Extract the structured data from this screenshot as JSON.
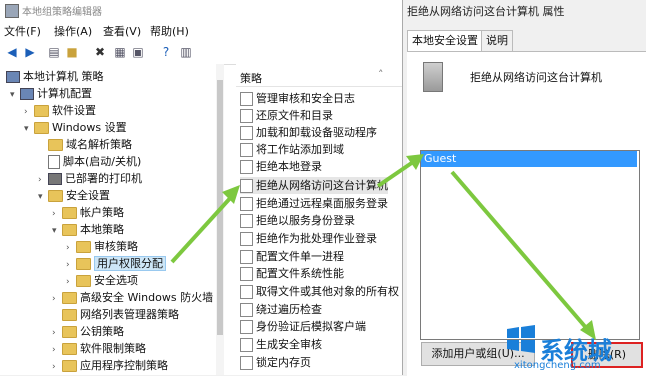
{
  "editor": {
    "title": "本地组策略编辑器",
    "menu": [
      "文件(F)",
      "操作(A)",
      "查看(V)",
      "帮助(H)"
    ],
    "toolbar_icons": [
      "back-icon",
      "forward-icon",
      "up-icon",
      "folder-icon",
      "delete-icon",
      "properties-icon",
      "export-icon",
      "help-icon",
      "view-icon"
    ],
    "tree": [
      {
        "label": "本地计算机 策略",
        "level": 0,
        "icon": "pc-icon",
        "arrow": ""
      },
      {
        "label": "计算机配置",
        "level": 1,
        "icon": "pc-icon",
        "arrow": "▾"
      },
      {
        "label": "软件设置",
        "level": 2,
        "icon": "folder-icon",
        "arrow": "›"
      },
      {
        "label": "Windows 设置",
        "level": 2,
        "icon": "folder-icon",
        "arrow": "▾"
      },
      {
        "label": "域名解析策略",
        "level": 3,
        "icon": "folder-icon",
        "arrow": ""
      },
      {
        "label": "脚本(启动/关机)",
        "level": 3,
        "icon": "doc-icon",
        "arrow": ""
      },
      {
        "label": "已部署的打印机",
        "level": 3,
        "icon": "printer-icon",
        "arrow": "›"
      },
      {
        "label": "安全设置",
        "level": 3,
        "icon": "folder-icon",
        "arrow": "▾"
      },
      {
        "label": "帐户策略",
        "level": 4,
        "icon": "folder-icon",
        "arrow": "›"
      },
      {
        "label": "本地策略",
        "level": 4,
        "icon": "folder-icon",
        "arrow": "▾"
      },
      {
        "label": "审核策略",
        "level": 5,
        "icon": "folder-icon",
        "arrow": "›"
      },
      {
        "label": "用户权限分配",
        "level": 5,
        "icon": "folder-icon",
        "arrow": "›",
        "selected": true
      },
      {
        "label": "安全选项",
        "level": 5,
        "icon": "folder-icon",
        "arrow": "›"
      },
      {
        "label": "高级安全 Windows 防火墙",
        "level": 4,
        "icon": "folder-icon",
        "arrow": "›"
      },
      {
        "label": "网络列表管理器策略",
        "level": 4,
        "icon": "folder-icon",
        "arrow": ""
      },
      {
        "label": "公钥策略",
        "level": 4,
        "icon": "folder-icon",
        "arrow": "›"
      },
      {
        "label": "软件限制策略",
        "level": 4,
        "icon": "folder-icon",
        "arrow": "›"
      },
      {
        "label": "应用程序控制策略",
        "level": 4,
        "icon": "folder-icon",
        "arrow": "›"
      }
    ],
    "policy_header": "策略",
    "policies": [
      {
        "label": "管理审核和安全日志"
      },
      {
        "label": "还原文件和目录"
      },
      {
        "label": "加载和卸载设备驱动程序"
      },
      {
        "label": "将工作站添加到域"
      },
      {
        "label": "拒绝本地登录"
      },
      {
        "label": "拒绝从网络访问这台计算机",
        "selected": true
      },
      {
        "label": "拒绝通过远程桌面服务登录"
      },
      {
        "label": "拒绝以服务身份登录"
      },
      {
        "label": "拒绝作为批处理作业登录"
      },
      {
        "label": "配置文件单一进程"
      },
      {
        "label": "配置文件系统性能"
      },
      {
        "label": "取得文件或其他对象的所有权"
      },
      {
        "label": "绕过遍历检查"
      },
      {
        "label": "身份验证后模拟客户端"
      },
      {
        "label": "生成安全审核"
      },
      {
        "label": "锁定内存页"
      }
    ]
  },
  "dialog": {
    "title": "拒绝从网络访问这台计算机 属性",
    "tabs": [
      "本地安全设置",
      "说明"
    ],
    "policy_name": "拒绝从网络访问这台计算机",
    "list_items": [
      "Guest"
    ],
    "add_button": "添加用户或组(U)...",
    "remove_button": "删除(R)"
  },
  "watermark": {
    "text": "系统城",
    "url": "xitongcheng.com"
  },
  "colors": {
    "arrow_green": "#7dc83f",
    "selection_blue": "#3399ff",
    "highlight_red": "#dd2222"
  }
}
